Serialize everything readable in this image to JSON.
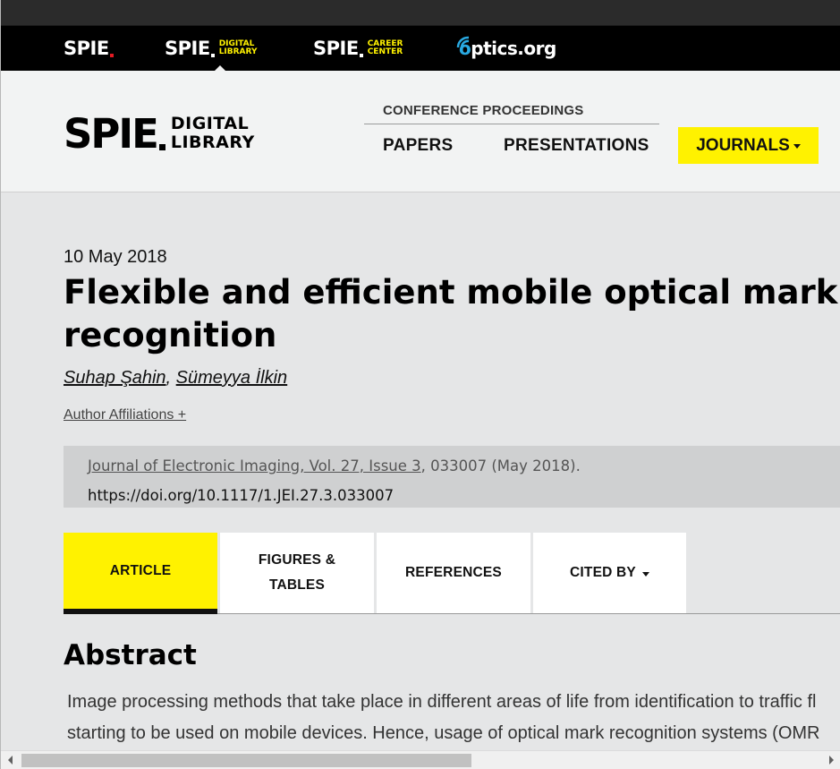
{
  "brandbar": {
    "items": [
      {
        "name": "SPIE",
        "sub": "",
        "dot_color": "#e31b23"
      },
      {
        "name": "SPIE",
        "sub_line1": "DIGITAL",
        "sub_line2": "LIBRARY",
        "dot_color": "#fff200"
      },
      {
        "name": "SPIE",
        "sub_line1": "CAREER",
        "sub_line2": "CENTER",
        "dot_color": "#fff200"
      }
    ],
    "optics": {
      "o": "o",
      "rest": "ptics.org"
    }
  },
  "header": {
    "logo_main": "SPIE",
    "logo_sub1": "DIGITAL",
    "logo_sub2": "LIBRARY",
    "conference_proceedings": "CONFERENCE PROCEEDINGS",
    "nav": {
      "papers": "PAPERS",
      "presentations": "PRESENTATIONS",
      "journals": "JOURNALS"
    }
  },
  "article": {
    "date": "10 May 2018",
    "title_line1": "Flexible and efficient mobile optical mark",
    "title_line2": "recognition",
    "authors": [
      "Suhap Şahin",
      "Sümeyya İlkin"
    ],
    "author_sep": ", ",
    "affiliations_toggle": "Author Affiliations +",
    "citation": {
      "journal_link": "Journal of Electronic Imaging, Vol. 27, Issue 3",
      "rest": ", 033007 (May 2018).",
      "doi": "https://doi.org/10.1117/1.JEI.27.3.033007"
    }
  },
  "tabs": {
    "article": "ARTICLE",
    "figures_line1": "FIGURES &",
    "figures_line2": "TABLES",
    "references": "REFERENCES",
    "cited_by": "CITED BY"
  },
  "abstract": {
    "heading": "Abstract",
    "line1": "Image processing methods that take place in different areas of life from identification to traffic fl",
    "line2": "starting to be used on mobile devices. Hence, usage of optical mark recognition systems (OMR"
  },
  "colors": {
    "accent_yellow": "#fff200",
    "spie_red": "#e31b23",
    "optics_blue": "#29a9e1"
  }
}
